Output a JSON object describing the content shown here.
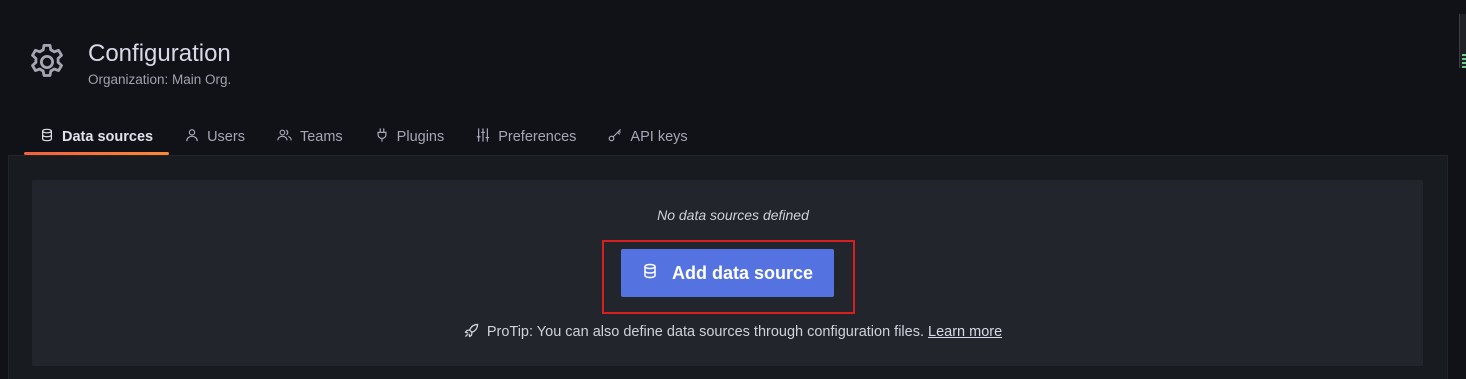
{
  "header": {
    "icon": "gear-icon",
    "title": "Configuration",
    "subtitle": "Organization: Main Org."
  },
  "tabs": [
    {
      "label": "Data sources",
      "icon": "database-icon",
      "active": true
    },
    {
      "label": "Users",
      "icon": "user-icon",
      "active": false
    },
    {
      "label": "Teams",
      "icon": "users-icon",
      "active": false
    },
    {
      "label": "Plugins",
      "icon": "plug-icon",
      "active": false
    },
    {
      "label": "Preferences",
      "icon": "sliders-icon",
      "active": false
    },
    {
      "label": "API keys",
      "icon": "key-icon",
      "active": false
    }
  ],
  "empty_state": {
    "title": "No data sources defined",
    "button_label": "Add data source",
    "button_icon": "database-icon",
    "protip_icon": "rocket-icon",
    "protip_text": "ProTip: You can also define data sources through configuration files.",
    "learn_more": "Learn more"
  },
  "colors": {
    "background": "#111217",
    "panel": "#22252b",
    "primary_button": "#5473e0",
    "active_tab_underline": "#f55f3e",
    "highlight_box": "#d71f22"
  }
}
